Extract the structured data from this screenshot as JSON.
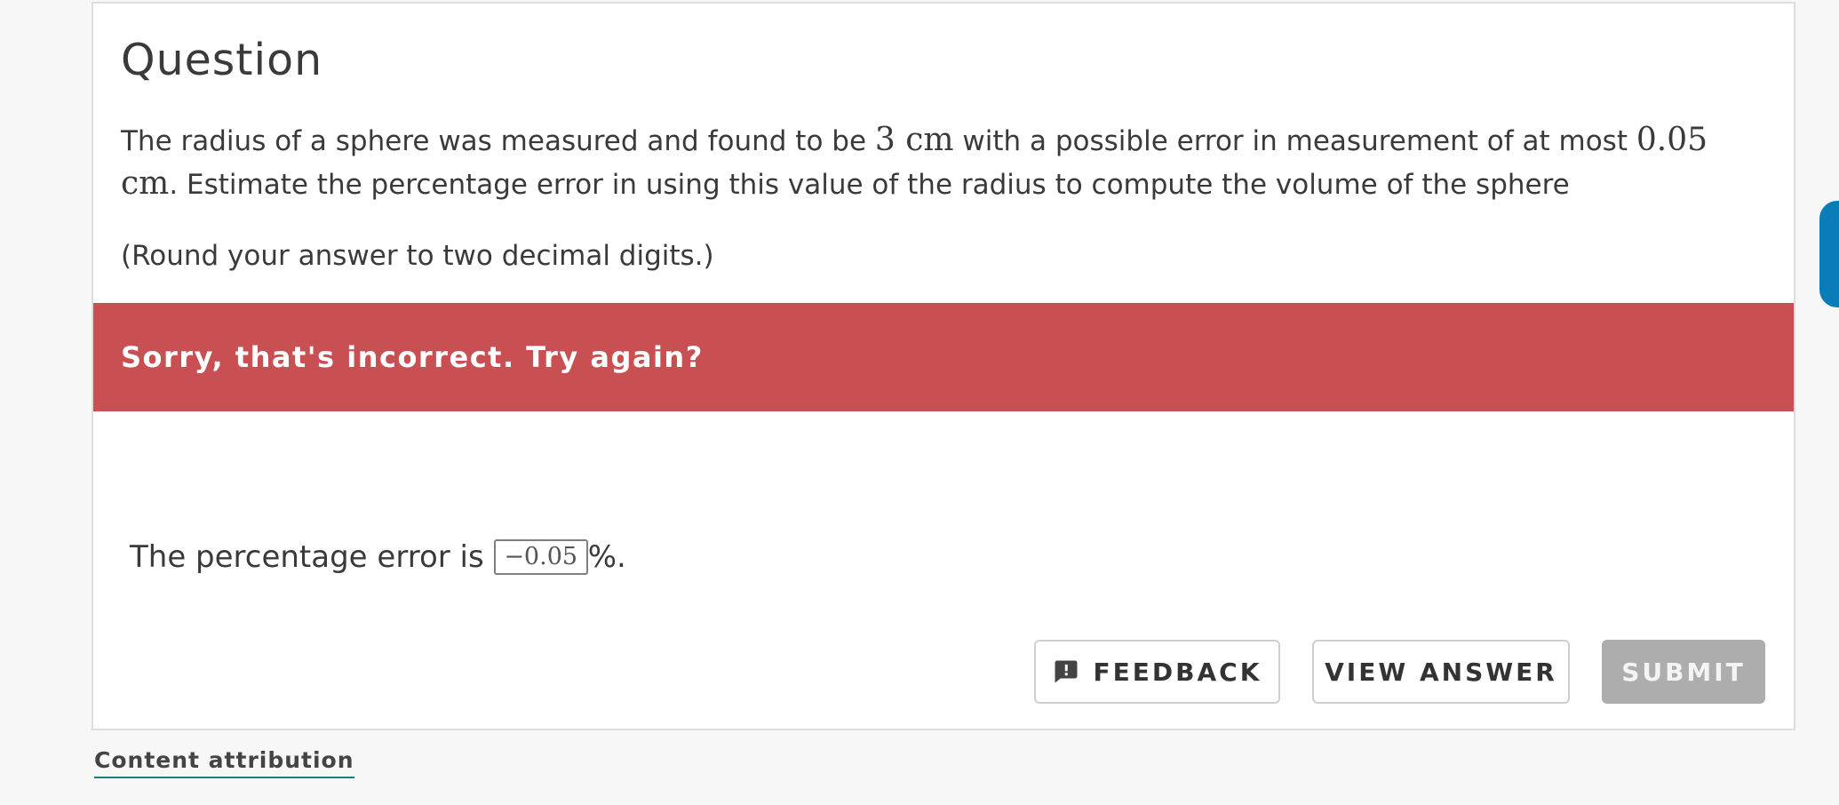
{
  "question": {
    "title": "Question",
    "text_before_radius": "The radius of a sphere was measured and found to be ",
    "radius": "3 cm",
    "text_before_error": " with a possible error in measurement of at most ",
    "max_error": "0.05 cm",
    "text_end": ". Estimate the percentage error in using this value of the radius to compute the volume of the sphere",
    "rounding_note": "(Round your answer to two decimal digits.)"
  },
  "alert": {
    "message": "Sorry, that's incorrect. Try again?",
    "color": "#c84f52"
  },
  "answer": {
    "prefix": "The percentage error is",
    "value": "−0.05",
    "suffix": "%."
  },
  "buttons": {
    "feedback_label": "FEEDBACK",
    "feedback_icon": "feedback-icon",
    "view_answer_label": "VIEW ANSWER",
    "submit_label": "SUBMIT"
  },
  "footer": {
    "attribution_label": "Content attribution"
  },
  "colors": {
    "submit_disabled": "#adadad",
    "side_tab": "#0a7db8",
    "attribution_underline": "#1f7f7f"
  }
}
